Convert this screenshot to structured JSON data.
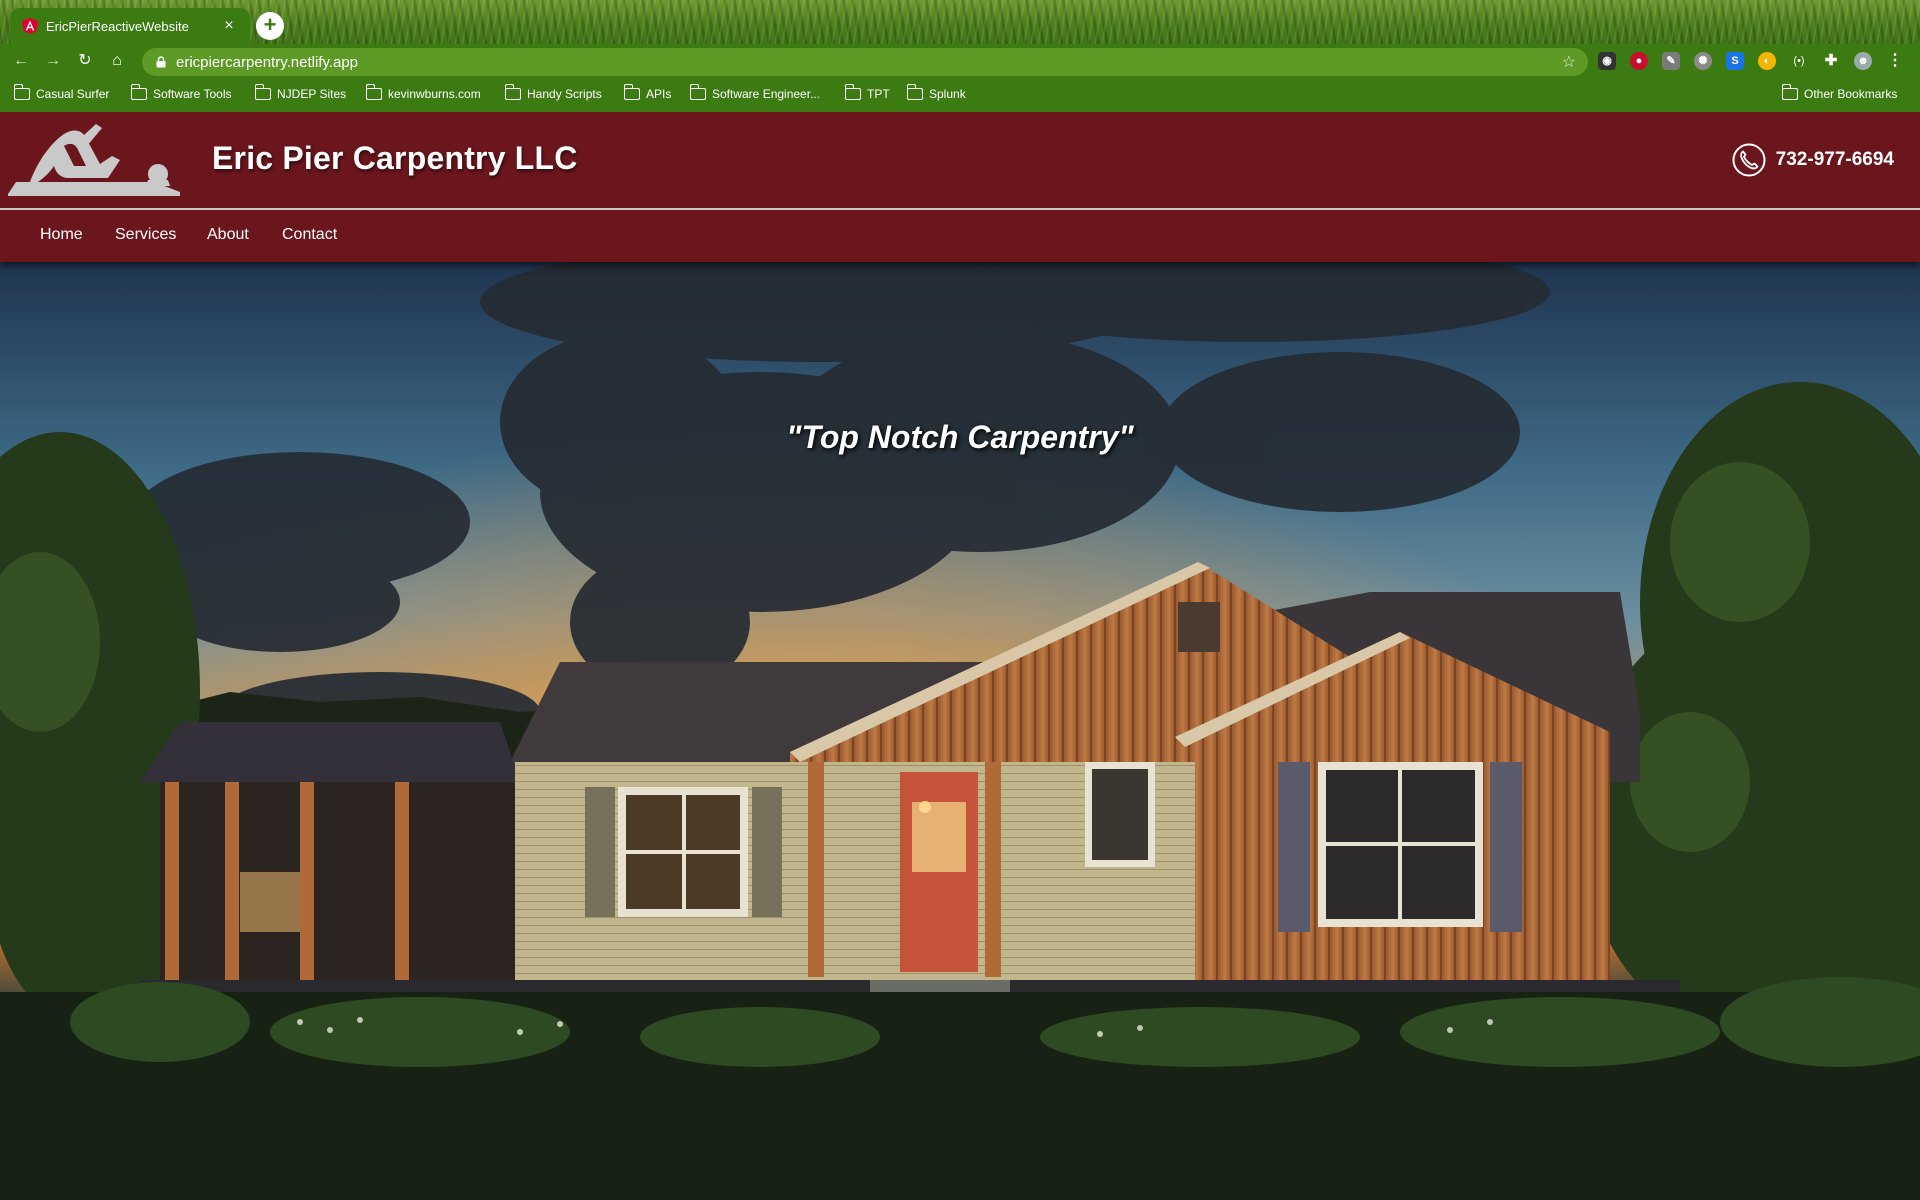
{
  "browser": {
    "tab_title": "EricPierReactiveWebsite",
    "tab_close": "×",
    "new_tab": "+",
    "url": "ericpiercarpentry.netlify.app",
    "bookmarks": [
      "Casual Surfer",
      "Software Tools",
      "NJDEP Sites",
      "kevinwburns.com",
      "Handy Scripts",
      "APIs",
      "Software Engineer...",
      "TPT",
      "Splunk"
    ],
    "other_bookmarks": "Other Bookmarks",
    "colors": {
      "chrome_green": "#3c7a12",
      "omnibox": "#5d9a26"
    }
  },
  "site": {
    "brand": "Eric Pier Carpentry LLC",
    "phone": "732-977-6694",
    "nav": [
      "Home",
      "Services",
      "About",
      "Contact"
    ],
    "tagline": "\"Top Notch Carpentry\"",
    "colors": {
      "header_bg": "#6b161c",
      "text": "#ffffff"
    }
  },
  "icons": [
    "back-icon",
    "forward-icon",
    "reload-icon",
    "home-icon",
    "lock-icon",
    "star-icon",
    "extensions-icon",
    "profile-icon",
    "menu-icon",
    "folder-icon",
    "phone-icon",
    "hand-plane-logo"
  ]
}
